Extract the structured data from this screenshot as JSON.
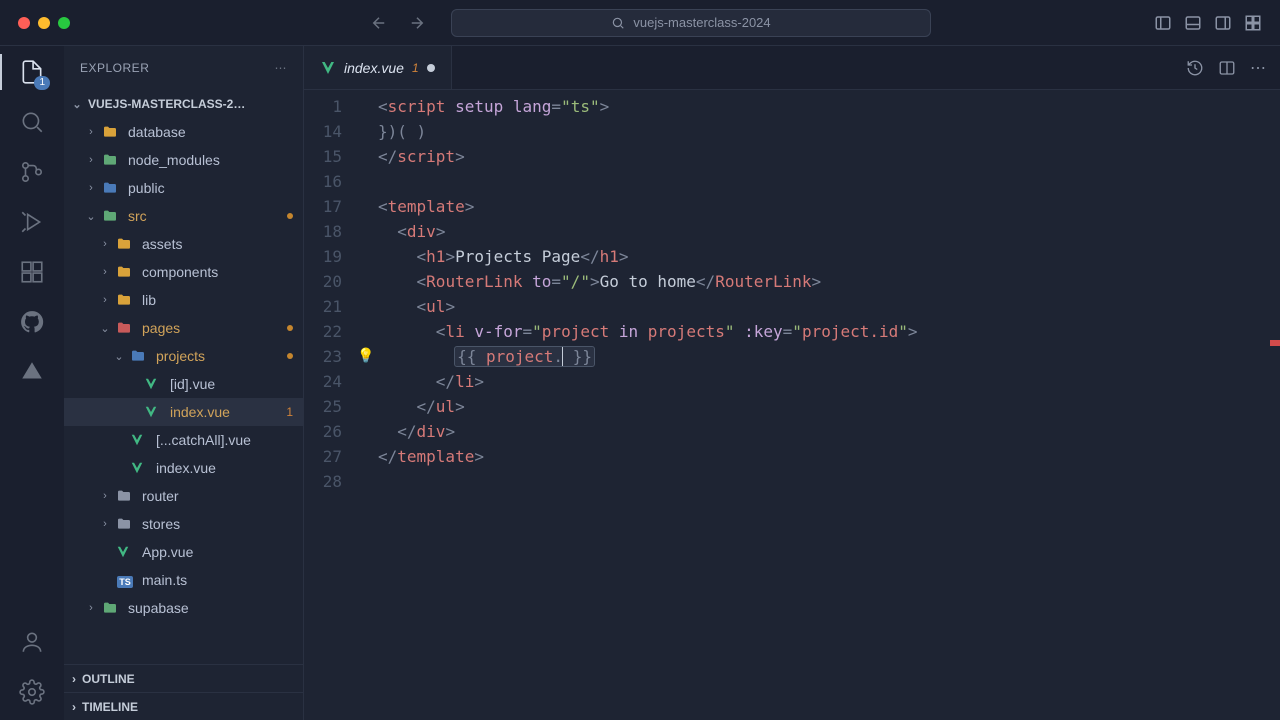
{
  "window": {
    "project_name": "vuejs-masterclass-2024"
  },
  "activity": {
    "explorer_badge": "1"
  },
  "explorer": {
    "title": "EXPLORER",
    "section_label": "VUEJS-MASTERCLASS-2…",
    "items": [
      {
        "label": "database",
        "kind": "folder",
        "depth": 1,
        "chev": "›",
        "color": "folder-yellow"
      },
      {
        "label": "node_modules",
        "kind": "folder",
        "depth": 1,
        "chev": "›",
        "color": "folder-green"
      },
      {
        "label": "public",
        "kind": "folder",
        "depth": 1,
        "chev": "›",
        "color": "folder-blue"
      },
      {
        "label": "src",
        "kind": "folder",
        "depth": 1,
        "chev": "⌄",
        "color": "folder-green",
        "modified": true
      },
      {
        "label": "assets",
        "kind": "folder",
        "depth": 2,
        "chev": "›",
        "color": "folder-yellow"
      },
      {
        "label": "components",
        "kind": "folder",
        "depth": 2,
        "chev": "›",
        "color": "folder-yellow"
      },
      {
        "label": "lib",
        "kind": "folder",
        "depth": 2,
        "chev": "›",
        "color": "folder-yellow"
      },
      {
        "label": "pages",
        "kind": "folder",
        "depth": 2,
        "chev": "⌄",
        "color": "folder-red",
        "modified": true
      },
      {
        "label": "projects",
        "kind": "folder",
        "depth": 3,
        "chev": "⌄",
        "color": "folder-blue",
        "modified": true
      },
      {
        "label": "[id].vue",
        "kind": "file",
        "depth": 4,
        "color": "file-vue"
      },
      {
        "label": "index.vue",
        "kind": "file",
        "depth": 4,
        "color": "file-vue",
        "selected": true,
        "modified": true,
        "badge": "1"
      },
      {
        "label": "[...catchAll].vue",
        "kind": "file",
        "depth": 3,
        "color": "file-vue"
      },
      {
        "label": "index.vue",
        "kind": "file",
        "depth": 3,
        "color": "file-vue"
      },
      {
        "label": "router",
        "kind": "folder",
        "depth": 2,
        "chev": "›",
        "color": "folder-gray"
      },
      {
        "label": "stores",
        "kind": "folder",
        "depth": 2,
        "chev": "›",
        "color": "folder-gray"
      },
      {
        "label": "App.vue",
        "kind": "file",
        "depth": 2,
        "color": "file-vue"
      },
      {
        "label": "main.ts",
        "kind": "file",
        "depth": 2,
        "color": "file-ts",
        "iconText": "TS"
      },
      {
        "label": "supabase",
        "kind": "folder",
        "depth": 1,
        "chev": "›",
        "color": "folder-green"
      }
    ],
    "outline": "OUTLINE",
    "timeline": "TIMELINE"
  },
  "tab": {
    "filename": "index.vue",
    "problems": "1"
  },
  "editor": {
    "line_numbers": [
      "1",
      "14",
      "15",
      "16",
      "17",
      "18",
      "19",
      "20",
      "21",
      "22",
      "23",
      "24",
      "25",
      "26",
      "27",
      "28"
    ],
    "bulb_line_index": 10,
    "code_lines_html": [
      "<span class='tok-punct'>&lt;</span><span class='tok-tag'>script</span> <span class='tok-attr'>setup</span> <span class='tok-attr'>lang</span><span class='tok-punct'>=</span><span class='tok-str'>\"ts\"</span><span class='tok-punct'>&gt;</span>",
      "<span class='tok-punct'>})( )</span>",
      "<span class='tok-punct'>&lt;/</span><span class='tok-tag'>script</span><span class='tok-punct'>&gt;</span>",
      "",
      "<span class='tok-punct'>&lt;</span><span class='tok-tag'>template</span><span class='tok-punct'>&gt;</span>",
      "  <span class='tok-punct'>&lt;</span><span class='tok-tag'>div</span><span class='tok-punct'>&gt;</span>",
      "    <span class='tok-punct'>&lt;</span><span class='tok-tag'>h1</span><span class='tok-punct'>&gt;</span><span class='tok-text'>Projects Page</span><span class='tok-punct'>&lt;/</span><span class='tok-tag'>h1</span><span class='tok-punct'>&gt;</span>",
      "    <span class='tok-punct'>&lt;</span><span class='tok-tag'>RouterLink</span> <span class='tok-attr'>to</span><span class='tok-punct'>=</span><span class='tok-str'>\"/\"</span><span class='tok-punct'>&gt;</span><span class='tok-text'>Go to home</span><span class='tok-punct'>&lt;/</span><span class='tok-tag'>RouterLink</span><span class='tok-punct'>&gt;</span>",
      "    <span class='tok-punct'>&lt;</span><span class='tok-tag'>ul</span><span class='tok-punct'>&gt;</span>",
      "      <span class='tok-punct'>&lt;</span><span class='tok-tag'>li</span> <span class='tok-attr'>v-for</span><span class='tok-punct'>=</span><span class='tok-str'>\"</span><span class='tok-var'>project</span><span class='tok-str'> </span><span class='tok-kw'>in</span><span class='tok-str'> </span><span class='tok-var'>projects</span><span class='tok-str'>\"</span> <span class='tok-attr'>:key</span><span class='tok-punct'>=</span><span class='tok-str'>\"</span><span class='tok-var'>project.id</span><span class='tok-str'>\"</span><span class='tok-punct'>&gt;</span>",
      "        <span class='hl-box'><span class='tok-punct'>{{</span> <span class='tok-var'>project</span><span class='tok-punct'>.</span><span class='cursor-mark'></span> <span class='tok-punct'>}}</span></span>",
      "      <span class='tok-punct'>&lt;/</span><span class='tok-tag'>li</span><span class='tok-punct'>&gt;</span>",
      "    <span class='tok-punct'>&lt;/</span><span class='tok-tag'>ul</span><span class='tok-punct'>&gt;</span>",
      "  <span class='tok-punct'>&lt;/</span><span class='tok-tag'>div</span><span class='tok-punct'>&gt;</span>",
      "<span class='tok-punct'>&lt;/</span><span class='tok-tag'>template</span><span class='tok-punct'>&gt;</span>",
      ""
    ]
  }
}
